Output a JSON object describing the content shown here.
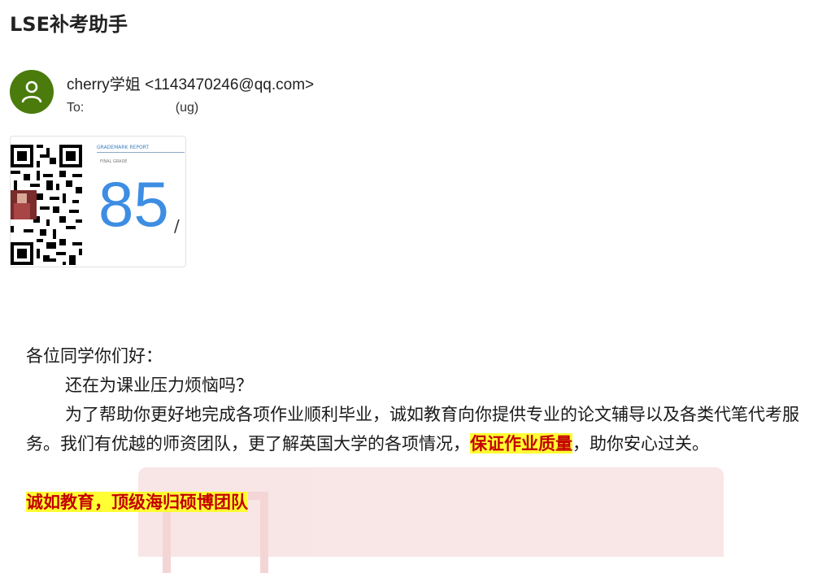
{
  "header": {
    "title": "LSE补考助手"
  },
  "email": {
    "sender": "cherry学姐 <1143470246@qq.com>",
    "to_label": "To:",
    "to_recipient": "(ug)"
  },
  "attachment": {
    "report_header": "GRADEMARK REPORT",
    "report_sub": "FINAL GRADE",
    "score": "85",
    "score_suffix": "/"
  },
  "body": {
    "greeting": "各位同学你们好：",
    "line1": "还在为课业压力烦恼吗？",
    "para_part1": "为了帮助你更好地完成各项作业顺利毕业，诚如教育向你提供专业的论文辅导以及各类代笔代考服务。我们有优越的师资团队，更了解英国大学的各项情况，",
    "highlight1": "保证作业质量",
    "para_part2": "，助你安心过关。",
    "slogan": "诚如教育，顶级海归硕博团队"
  },
  "colors": {
    "avatar_bg": "#4a7b0c",
    "score_color": "#3d8de3",
    "highlight_bg": "#ffff33",
    "highlight_text": "#c40000"
  }
}
